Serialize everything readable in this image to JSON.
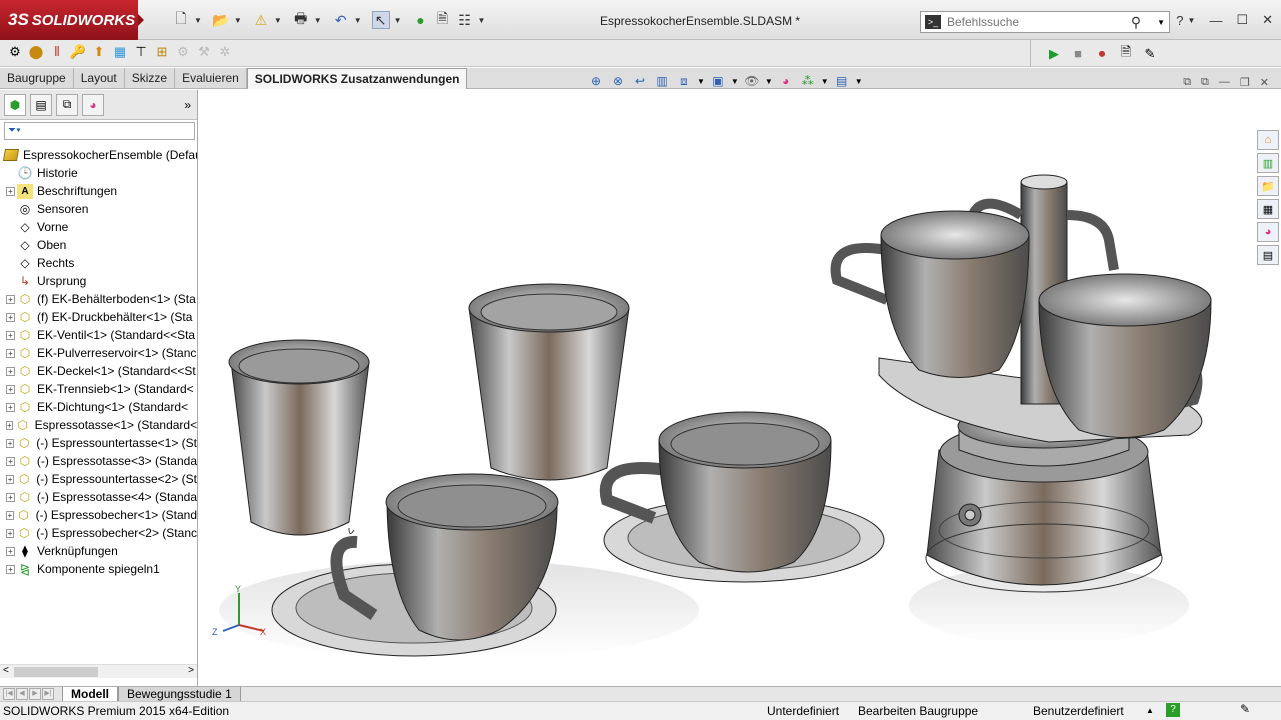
{
  "app": {
    "brand": "SOLIDWORKS",
    "brand_prefix": "3S"
  },
  "title": {
    "document": "EspressokocherEnsemble.SLDASM *"
  },
  "search": {
    "placeholder": "Befehlssuche"
  },
  "tabs": [
    {
      "label": "Baugruppe",
      "active": false
    },
    {
      "label": "Layout",
      "active": false
    },
    {
      "label": "Skizze",
      "active": false
    },
    {
      "label": "Evaluieren",
      "active": false
    },
    {
      "label": "SOLIDWORKS Zusatzanwendungen",
      "active": true
    }
  ],
  "tree": {
    "root": "EspressokocherEnsemble  (Default",
    "items": [
      {
        "label": "Historie",
        "icon": "history-icon",
        "expand": false
      },
      {
        "label": "Beschriftungen",
        "icon": "annotations-icon",
        "expand": true
      },
      {
        "label": "Sensoren",
        "icon": "sensor-icon",
        "expand": false
      },
      {
        "label": "Vorne",
        "icon": "plane-icon",
        "expand": false
      },
      {
        "label": "Oben",
        "icon": "plane-icon",
        "expand": false
      },
      {
        "label": "Rechts",
        "icon": "plane-icon",
        "expand": false
      },
      {
        "label": "Ursprung",
        "icon": "origin-icon",
        "expand": false
      },
      {
        "label": "(f) EK-Behälterboden<1> (Sta",
        "icon": "part-icon",
        "expand": true
      },
      {
        "label": "(f) EK-Druckbehälter<1> (Sta",
        "icon": "part-icon",
        "expand": true
      },
      {
        "label": "EK-Ventil<1> (Standard<<Sta",
        "icon": "part-icon",
        "expand": true
      },
      {
        "label": "EK-Pulverreservoir<1> (Stanc",
        "icon": "part-icon",
        "expand": true
      },
      {
        "label": "EK-Deckel<1> (Standard<<St",
        "icon": "part-icon",
        "expand": true
      },
      {
        "label": "EK-Trennsieb<1> (Standard<",
        "icon": "part-icon",
        "expand": true
      },
      {
        "label": "EK-Dichtung<1> (Standard<",
        "icon": "part-icon",
        "expand": true
      },
      {
        "label": "Espressotasse<1> (Standard<",
        "icon": "part-icon",
        "expand": true
      },
      {
        "label": "(-) Espressountertasse<1> (St",
        "icon": "part-icon",
        "expand": true
      },
      {
        "label": "(-) Espressotasse<3> (Standa",
        "icon": "part-icon",
        "expand": true
      },
      {
        "label": "(-) Espressountertasse<2> (St",
        "icon": "part-icon",
        "expand": true
      },
      {
        "label": "(-) Espressotasse<4> (Standa",
        "icon": "part-icon",
        "expand": true
      },
      {
        "label": "(-) Espressobecher<1> (Stand",
        "icon": "part-icon",
        "expand": true
      },
      {
        "label": "(-) Espressobecher<2> (Stanc",
        "icon": "part-icon",
        "expand": true
      },
      {
        "label": "Verknüpfungen",
        "icon": "mates-icon",
        "expand": true
      },
      {
        "label": "Komponente spiegeln1",
        "icon": "mirror-component-icon",
        "expand": true
      }
    ]
  },
  "bottom_tabs": [
    {
      "label": "Modell",
      "active": true
    },
    {
      "label": "Bewegungsstudie 1",
      "active": false
    }
  ],
  "triad": {
    "x": "X",
    "y": "Y",
    "z": "Z"
  },
  "status": {
    "edition": "SOLIDWORKS Premium 2015 x64-Edition",
    "definition": "Unterdefiniert",
    "mode": "Bearbeiten Baugruppe",
    "units": "Benutzerdefiniert",
    "units_arrow": "▲"
  },
  "colors": {
    "brand": "#c8262f",
    "viewport_bg": "#ffffff",
    "metal": "#8a8a8a"
  }
}
